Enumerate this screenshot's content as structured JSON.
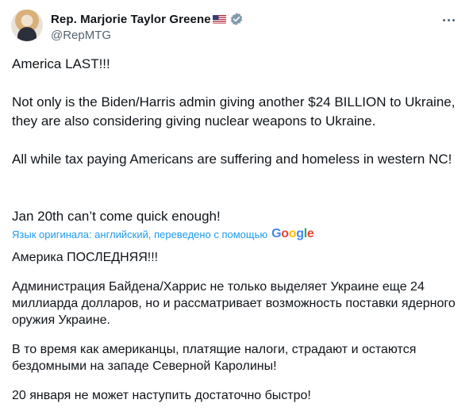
{
  "author": {
    "display_name": "Rep. Marjorie Taylor Greene",
    "handle": "@RepMTG"
  },
  "icons": {
    "flag": "us-flag-icon",
    "verified": "verified-badge-icon",
    "more": "more-options-icon"
  },
  "tweet": {
    "original": [
      "America LAST!!!",
      "Not only is the Biden/Harris admin giving another $24 BILLION to Ukraine, they are also considering giving nuclear weapons to Ukraine.",
      "All while tax paying Americans are suffering and homeless in western NC!",
      "Jan 20th can’t come quick enough!"
    ],
    "translation_note": "Язык оригинала: английский, переведено с помощью",
    "translation_provider": "Google",
    "translated": [
      "Америка ПОСЛЕДНЯЯ!!!",
      "Администрация Байдена/Харрис не только выделяет Украине еще 24 миллиарда долларов, но и рассматривает возможность поставки ядерного оружия Украине.",
      "В то время как американцы, платящие налоги, страдают и остаются бездомными на западе Северной Каролины!",
      "20 января не может наступить достаточно быстро!"
    ]
  },
  "colors": {
    "text": "#0f1419",
    "secondary": "#536471",
    "link": "#1d9bf0",
    "verified": "#829aab"
  }
}
